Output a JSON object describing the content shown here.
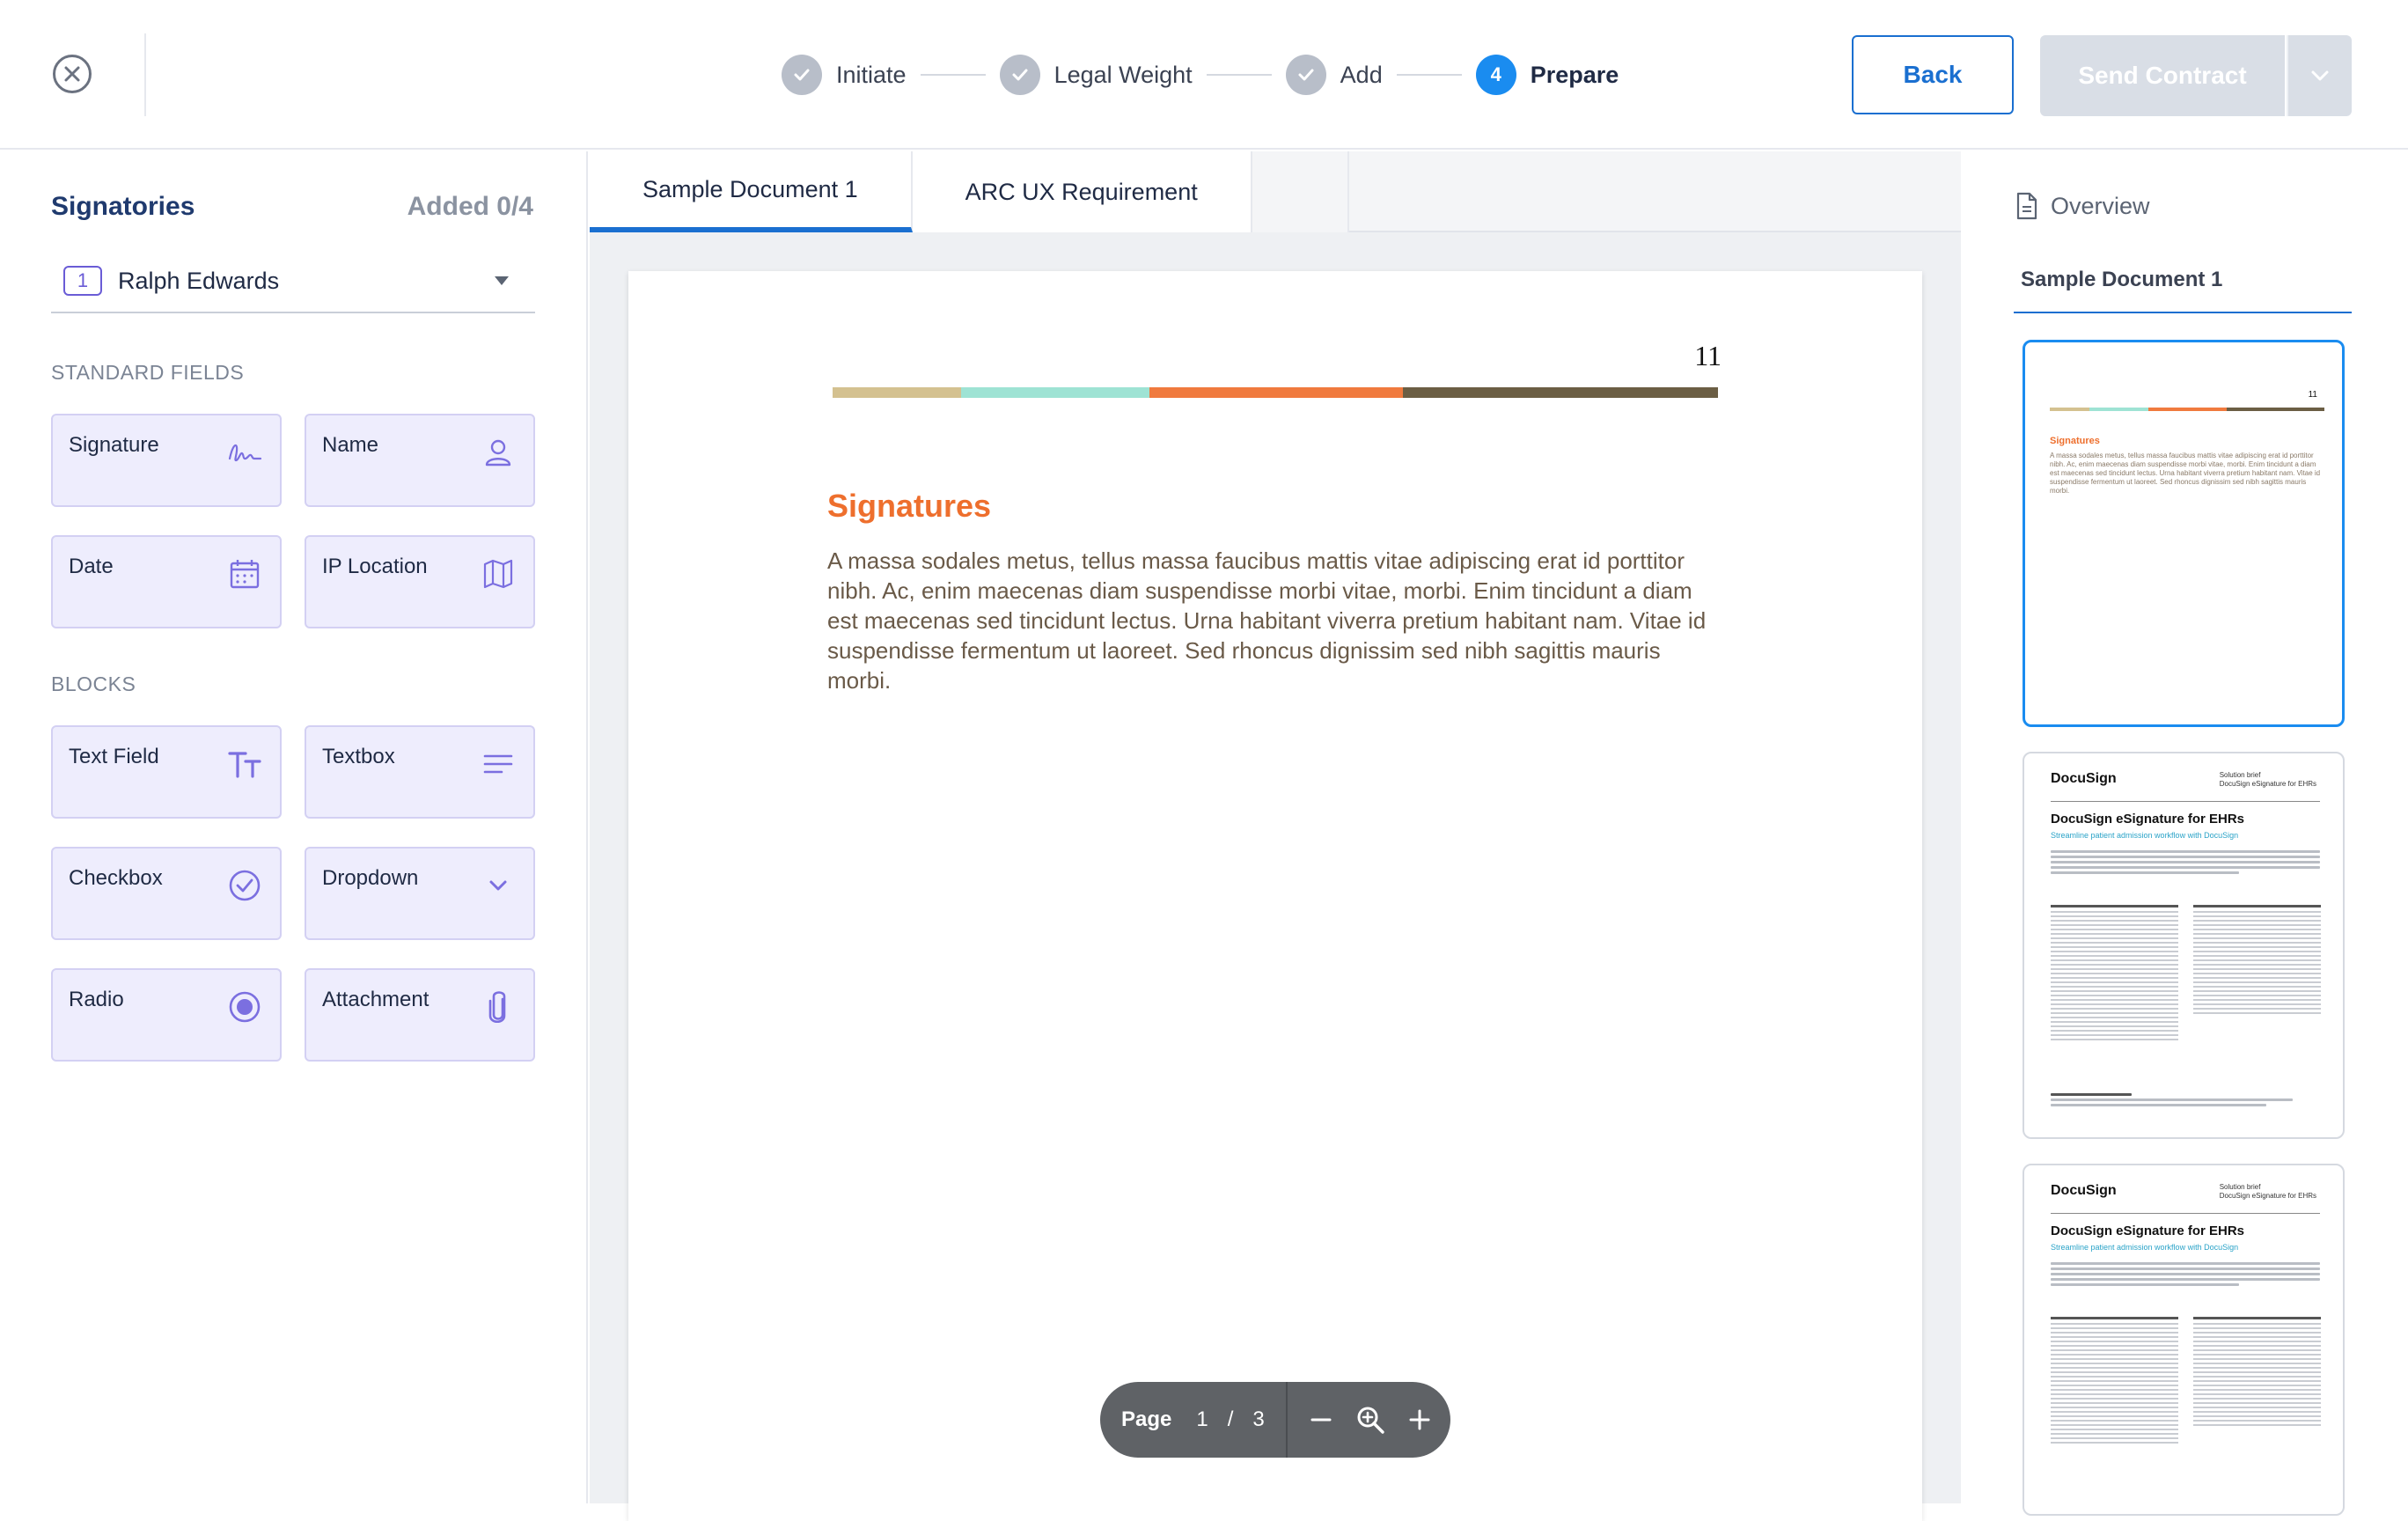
{
  "header": {
    "steps": [
      {
        "label": "Initiate",
        "state": "done"
      },
      {
        "label": "Legal Weight",
        "state": "done"
      },
      {
        "label": "Add",
        "state": "done"
      },
      {
        "label": "Prepare",
        "state": "active",
        "number": "4"
      }
    ],
    "back_label": "Back",
    "send_label": "Send Contract"
  },
  "signatories": {
    "title": "Signatories",
    "added": "Added 0/4",
    "selected_number": "1",
    "selected_name": "Ralph Edwards"
  },
  "standard_fields": {
    "label": "STANDARD FIELDS",
    "items": [
      {
        "label": "Signature",
        "icon": "signature-icon"
      },
      {
        "label": "Name",
        "icon": "person-icon"
      },
      {
        "label": "Date",
        "icon": "calendar-icon"
      },
      {
        "label": "IP Location",
        "icon": "map-icon"
      }
    ]
  },
  "blocks": {
    "label": "BLOCKS",
    "items": [
      {
        "label": "Text Field",
        "icon": "text-size-icon"
      },
      {
        "label": "Textbox",
        "icon": "text-lines-icon"
      },
      {
        "label": "Checkbox",
        "icon": "check-circle-icon"
      },
      {
        "label": "Dropdown",
        "icon": "chevron-down-icon"
      },
      {
        "label": "Radio",
        "icon": "radio-icon"
      },
      {
        "label": "Attachment",
        "icon": "paperclip-icon"
      }
    ]
  },
  "document": {
    "tabs": [
      "Sample Document 1",
      "ARC UX Requirement"
    ],
    "page_number": "11",
    "heading": "Signatures",
    "body": "A massa sodales metus, tellus massa faucibus mattis vitae adipiscing erat id porttitor nibh. Ac, enim maecenas diam suspendisse morbi vitae, morbi. Enim tincidunt a diam est maecenas sed tincidunt lectus. Urna habitant viverra pretium habitant nam. Vitae id suspendisse fermentum ut laoreet. Sed rhoncus dignissim sed nibh sagittis mauris morbi.",
    "colors": [
      "#d4c190",
      "#9ee3d4",
      "#f07a3e",
      "#6b5e44"
    ]
  },
  "pager": {
    "label": "Page",
    "current": "1",
    "separator": "/",
    "total": "3"
  },
  "overview": {
    "title": "Overview",
    "doc_label": "Sample Document 1",
    "thumb_doc": {
      "logo": "DocuSign",
      "brief_line1": "Solution brief",
      "brief_line2": "DocuSign eSignature for EHRs",
      "title": "DocuSign eSignature for EHRs",
      "subtitle": "Streamline patient admission workflow with DocuSign"
    }
  }
}
